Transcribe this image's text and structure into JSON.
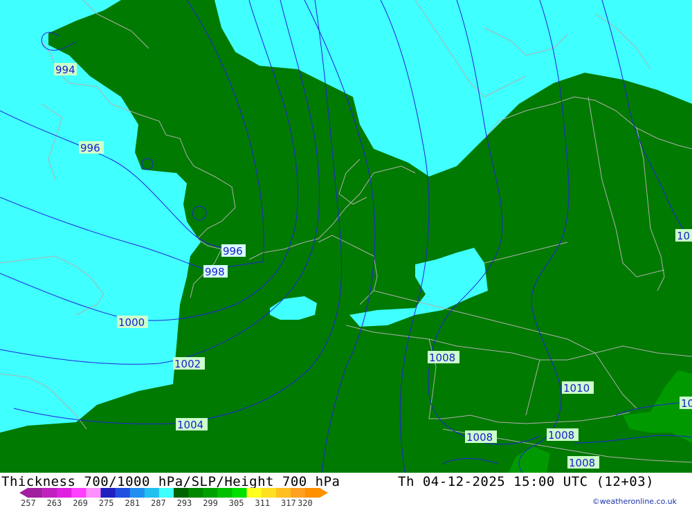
{
  "title": "Thickness 700/1000 hPa/SLP/Height 700 hPa",
  "valid_time": "Th 04-12-2025 15:00 UTC (12+03)",
  "credit": "©weatheronline.co.uk",
  "legend": {
    "ticks": [
      "257",
      "263",
      "269",
      "275",
      "281",
      "287",
      "293",
      "299",
      "305",
      "311",
      "317",
      "320"
    ],
    "colors": [
      "#a020a0",
      "#c020c0",
      "#e020e0",
      "#ff40ff",
      "#ff90ff",
      "#2020c0",
      "#2050e0",
      "#2090f0",
      "#20c0f0",
      "#40ffff",
      "#006400",
      "#008800",
      "#00a000",
      "#00c000",
      "#00e000",
      "#ffff20",
      "#ffe020",
      "#ffc020",
      "#ffa020",
      "#ff9000"
    ]
  },
  "isobar_labels": [
    "994",
    "996",
    "996",
    "998",
    "1000",
    "1002",
    "1004",
    "1008",
    "1008",
    "1008",
    "1008",
    "1010",
    "10",
    "10"
  ],
  "colors": {
    "cold_fill": "#40ffff",
    "warm_fill": "#007a00",
    "warmer_fill": "#009a00",
    "isobar_line": "#2222dd",
    "coastline": "#b0b0b0"
  }
}
